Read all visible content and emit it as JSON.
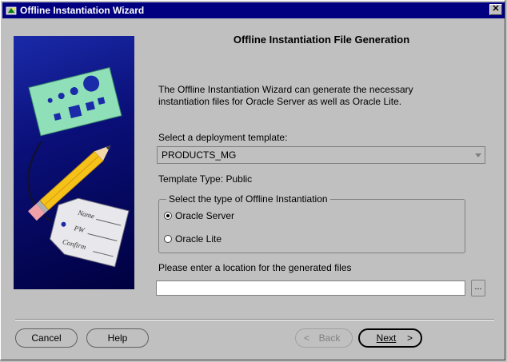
{
  "window": {
    "title": "Offline Instantiation Wizard",
    "close_glyph": "✕"
  },
  "page": {
    "heading": "Offline Instantiation File Generation",
    "description_line1": "The Offline Instantiation Wizard can generate the necessary",
    "description_line2": "instantiation files for Oracle Server as well as Oracle Lite."
  },
  "template": {
    "label": "Select a deployment template:",
    "selected": "PRODUCTS_MG",
    "type_label": "Template Type: Public"
  },
  "instantiation": {
    "legend": "Select the type of Offline Instantiation",
    "options": [
      {
        "label": "Oracle Server",
        "selected": true
      },
      {
        "label": "Oracle Lite",
        "selected": false
      }
    ]
  },
  "location": {
    "label": "Please enter a location for the generated files",
    "value": "",
    "browse_label": "..."
  },
  "buttons": {
    "cancel": "Cancel",
    "help": "Help",
    "back": "Back",
    "next": "Next",
    "back_glyph": "<",
    "next_glyph": ">"
  },
  "illustration_text": {
    "name": "Name",
    "pw": "PW",
    "confirm": "Confirm"
  },
  "colors": {
    "titlebar": "#000080",
    "face": "#c0c0c0",
    "illustration": "#0a0f78"
  }
}
